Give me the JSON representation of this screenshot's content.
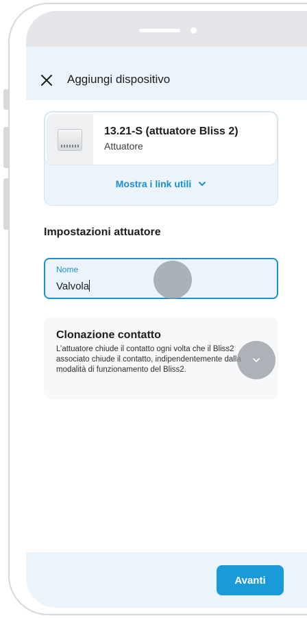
{
  "header": {
    "title": "Aggiungi dispositivo"
  },
  "product": {
    "name": "13.21-S (attuatore Bliss 2)",
    "type": "Attuatore",
    "links_label": "Mostra i link utili"
  },
  "settings": {
    "section_title": "Impostazioni attuatore",
    "name_field": {
      "label": "Nome",
      "value": "Valvola"
    }
  },
  "clone_contact": {
    "title": "Clonazione contatto",
    "description": "L’attuatore chiude il contatto ogni volta che il Bliss2 associato chiude il contatto, indipendentemente dalla modalità di funzionamento del Bliss2."
  },
  "footer": {
    "next_label": "Avanti"
  },
  "colors": {
    "accent": "#1a9ad8",
    "header_bg": "#eaf4fa"
  },
  "icons": {
    "close": "close-icon",
    "links_chevron": "chevron-down-icon",
    "expand": "chevron-down-icon"
  }
}
